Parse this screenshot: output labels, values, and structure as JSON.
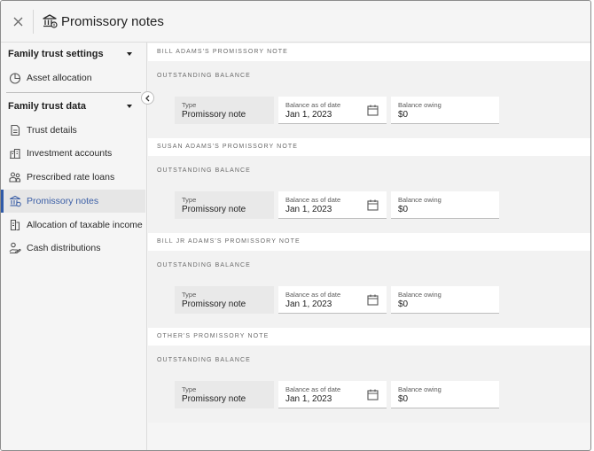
{
  "header": {
    "title": "Promissory notes",
    "close_icon": "close-icon",
    "page_icon": "bank-icon"
  },
  "sidebar": {
    "groups": [
      {
        "label": "Family trust settings",
        "items": [
          {
            "label": "Asset allocation",
            "icon": "pie-chart-icon"
          }
        ]
      },
      {
        "label": "Family trust data",
        "items": [
          {
            "label": "Trust details",
            "icon": "document-icon"
          },
          {
            "label": "Investment accounts",
            "icon": "buildings-icon"
          },
          {
            "label": "Prescribed rate loans",
            "icon": "people-icon"
          },
          {
            "label": "Promissory notes",
            "icon": "bank-icon",
            "active": true
          },
          {
            "label": "Allocation of taxable income",
            "icon": "split-document-icon"
          },
          {
            "label": "Cash distributions",
            "icon": "hand-coins-icon"
          }
        ]
      }
    ]
  },
  "notes": [
    {
      "title": "Bill Adams's promissory note",
      "section": "Outstanding balance",
      "type_label": "Type",
      "type_value": "Promissory note",
      "date_label": "Balance as of date",
      "date_value": "Jan 1, 2023",
      "owing_label": "Balance owing",
      "owing_value": "$0"
    },
    {
      "title": "Susan Adams's promissory note",
      "section": "Outstanding balance",
      "type_label": "Type",
      "type_value": "Promissory note",
      "date_label": "Balance as of date",
      "date_value": "Jan 1, 2023",
      "owing_label": "Balance owing",
      "owing_value": "$0"
    },
    {
      "title": "Bill Jr Adams's promissory note",
      "section": "Outstanding balance",
      "type_label": "Type",
      "type_value": "Promissory note",
      "date_label": "Balance as of date",
      "date_value": "Jan 1, 2023",
      "owing_label": "Balance owing",
      "owing_value": "$0"
    },
    {
      "title": "Other's promissory note",
      "section": "Outstanding balance",
      "type_label": "Type",
      "type_value": "Promissory note",
      "date_label": "Balance as of date",
      "date_value": "Jan 1, 2023",
      "owing_label": "Balance owing",
      "owing_value": "$0"
    }
  ],
  "colors": {
    "accent": "#2f5aa8",
    "active_bg": "#e6e6e6",
    "panel_bg": "#f2f2f2"
  }
}
